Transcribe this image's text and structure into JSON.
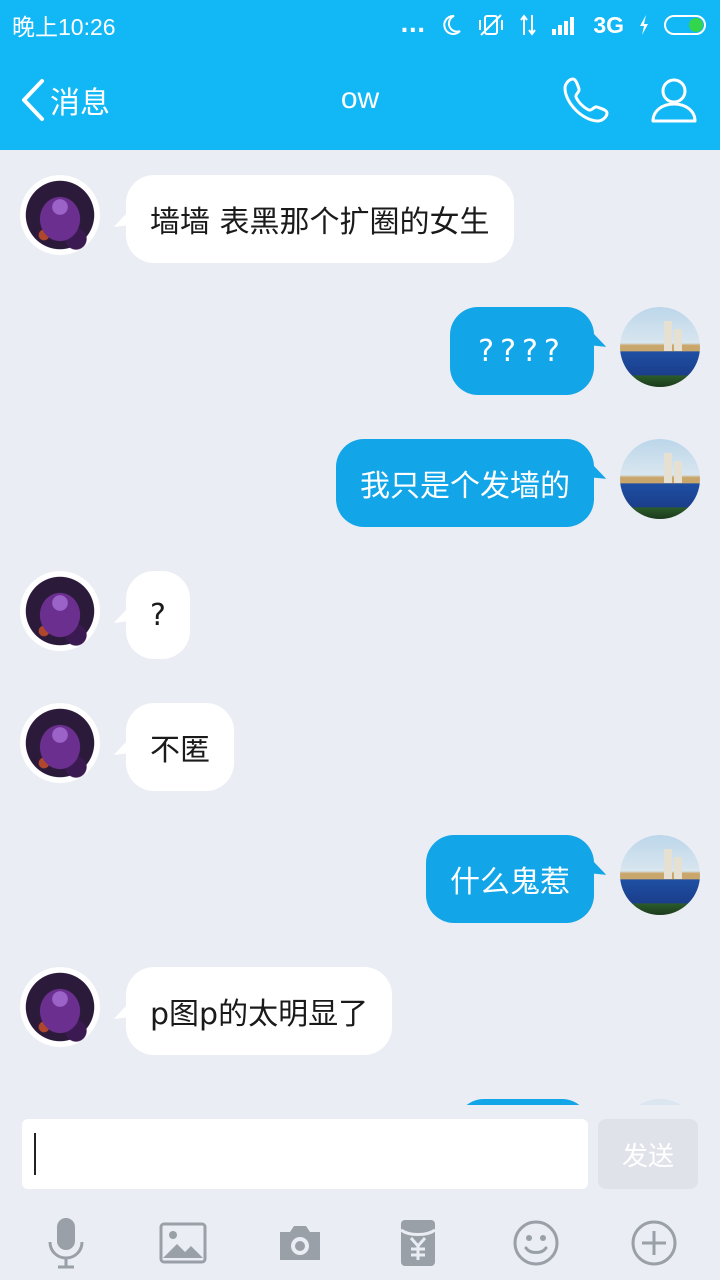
{
  "status_bar": {
    "time": "晚上10:26",
    "network": "3G",
    "dots": "...",
    "battery_color": "#33d54a"
  },
  "header": {
    "back_label": "消息",
    "title": "ow",
    "call_icon": "phone-icon",
    "profile_icon": "person-icon",
    "background": "#12b7f5"
  },
  "messages": [
    {
      "sender": "friend",
      "text": "墙墙 表黑那个扩圈的女生"
    },
    {
      "sender": "me",
      "text": "????"
    },
    {
      "sender": "me",
      "text": "我只是个发墙的"
    },
    {
      "sender": "friend",
      "text": "?"
    },
    {
      "sender": "friend",
      "text": "不匿"
    },
    {
      "sender": "me",
      "text": "什么鬼惹"
    },
    {
      "sender": "friend",
      "text": "p图p的太明显了"
    }
  ],
  "composer": {
    "input_value": "",
    "send_label": "发送"
  },
  "toolbar": {
    "items": [
      "microphone-icon",
      "image-icon",
      "camera-icon",
      "red-packet-icon",
      "emoji-icon",
      "plus-icon"
    ]
  },
  "colors": {
    "accent": "#12b7f5",
    "my_bubble": "#12a5e8",
    "friend_bubble": "#ffffff",
    "background": "#eaedf4"
  }
}
